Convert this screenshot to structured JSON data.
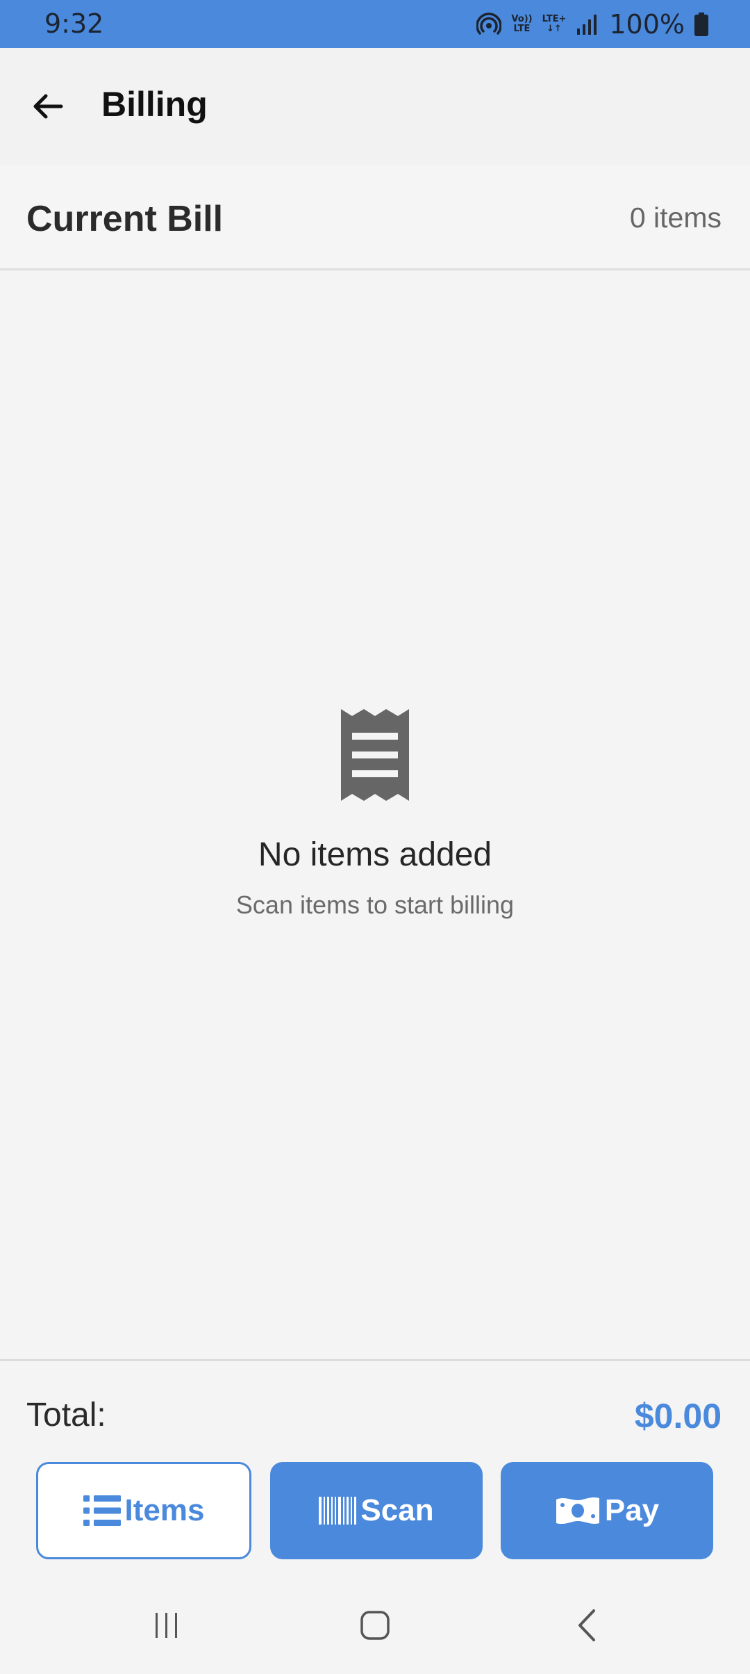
{
  "status_bar": {
    "time": "9:32",
    "network_top": "Vo)) LTE+",
    "network_volte": "Vo))",
    "network_lte": "LTE",
    "network_lteplus": "LTE+",
    "battery": "100%"
  },
  "app_bar": {
    "title": "Billing"
  },
  "bill": {
    "title": "Current Bill",
    "count": "0 items"
  },
  "empty": {
    "title": "No items added",
    "subtitle": "Scan items to start billing"
  },
  "footer": {
    "total_label": "Total:",
    "total_value": "$0.00",
    "items_label": "Items",
    "scan_label": "Scan",
    "pay_label": "Pay"
  },
  "colors": {
    "accent": "#4a89dc",
    "background": "#f4f4f5"
  },
  "icons": {
    "back": "arrow-left-icon",
    "receipt": "receipt-icon",
    "list": "list-icon",
    "barcode": "barcode-icon",
    "money": "money-bill-icon"
  }
}
